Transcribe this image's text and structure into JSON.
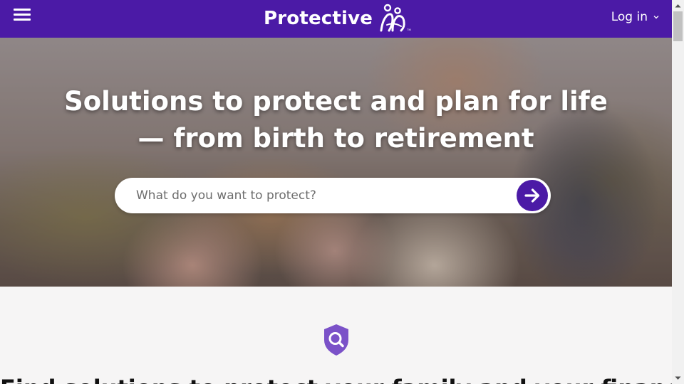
{
  "header": {
    "logo_text": "Protective",
    "login_label": "Log in",
    "brand_color": "#4b1aa6"
  },
  "hero": {
    "title_line1": "Solutions to protect and plan for life",
    "title_line2": "— from birth to retirement",
    "search_placeholder": "What do you want to protect?"
  },
  "section": {
    "heading": "Find solutions to protect your family and your finances"
  },
  "icons": {
    "menu": "hamburger-menu-icon",
    "logo": "protective-family-logo",
    "login_chevron": "chevron-down-icon",
    "search_submit": "arrow-right-icon",
    "section_badge": "shield-search-icon"
  }
}
